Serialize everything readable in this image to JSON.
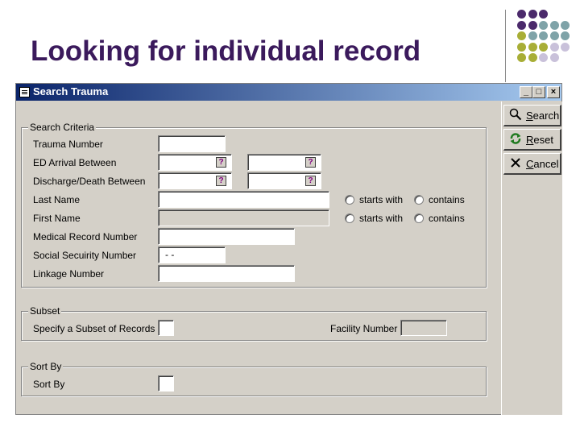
{
  "slide": {
    "title": "Looking for individual record"
  },
  "dot_colors": {
    "purple": "#4b2a6b",
    "teal": "#7fa3a8",
    "olive": "#a8ae36",
    "lavender": "#c9c1da"
  },
  "window": {
    "title": "Search Trauma",
    "controls": {
      "minimize": "_",
      "maximize": "□",
      "close": "×"
    }
  },
  "search_criteria": {
    "legend": "Search Criteria",
    "trauma_number_label": "Trauma Number",
    "trauma_number_value": "",
    "ed_arrival_label": "ED Arrival Between",
    "discharge_label": "Discharge/Death Between",
    "last_name_label": "Last Name",
    "first_name_label": "First Name",
    "mrn_label": "Medical Record Number",
    "ssn_label": "Social Secuirity Number",
    "ssn_value": " -  -",
    "linkage_label": "Linkage Number",
    "starts_with": "starts with",
    "contains": "contains"
  },
  "subset": {
    "legend": "Subset",
    "specify_label": "Specify a Subset of Records",
    "facility_label": "Facility Number"
  },
  "sort_by": {
    "legend": "Sort By",
    "sort_label": "Sort By"
  },
  "commands": {
    "search": "Search",
    "reset": "Reset",
    "cancel": "Cancel",
    "search_icon": "magnifier-icon",
    "reset_icon": "refresh-icon",
    "cancel_icon": "x-icon"
  }
}
